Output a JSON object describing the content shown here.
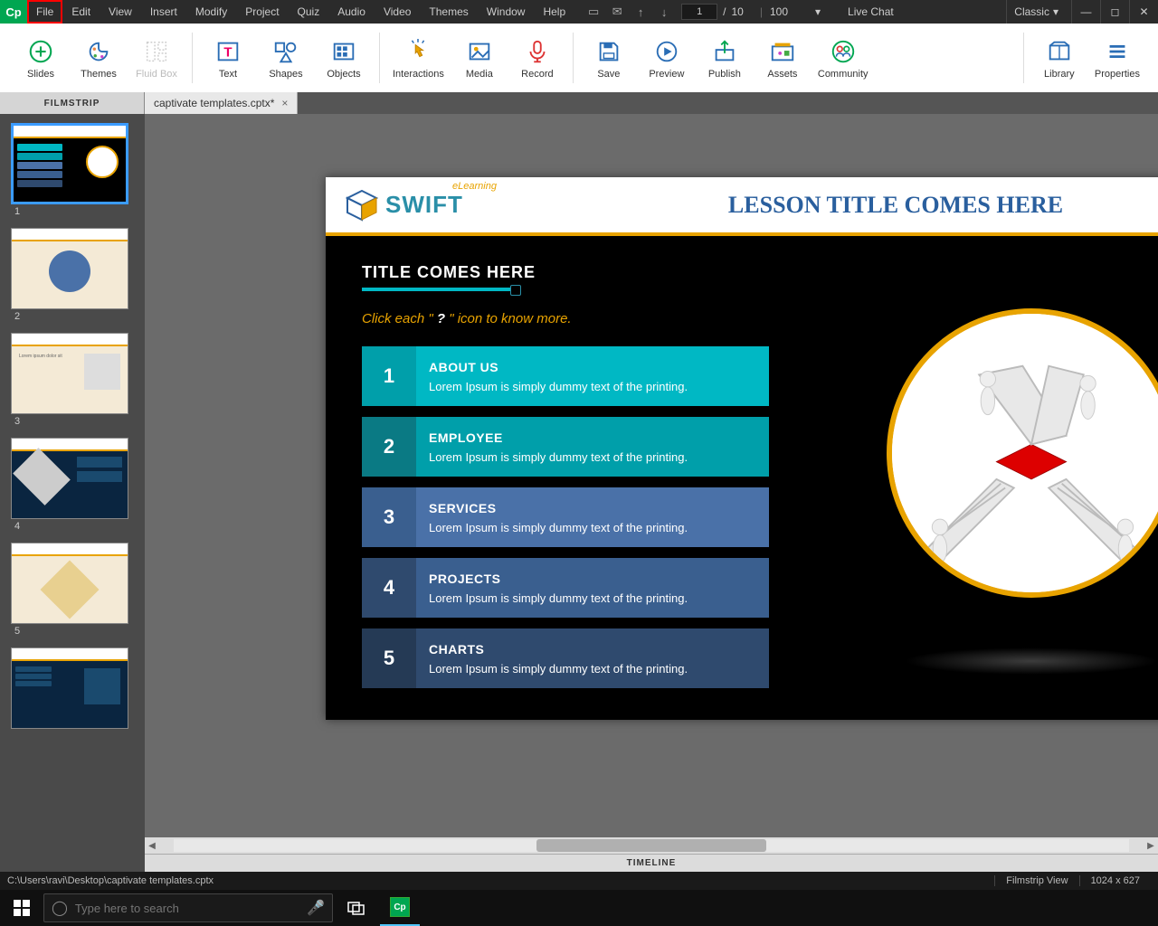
{
  "menubar": {
    "items": [
      "File",
      "Edit",
      "View",
      "Insert",
      "Modify",
      "Project",
      "Quiz",
      "Audio",
      "Video",
      "Themes",
      "Window",
      "Help"
    ],
    "slide_current": "1",
    "slide_sep": "/",
    "slide_total": "10",
    "zoom": "100",
    "live_chat": "Live Chat",
    "workspace": "Classic"
  },
  "ribbon": {
    "slides": "Slides",
    "themes": "Themes",
    "fluid": "Fluid Box",
    "text": "Text",
    "shapes": "Shapes",
    "objects": "Objects",
    "interactions": "Interactions",
    "media": "Media",
    "record": "Record",
    "save": "Save",
    "preview": "Preview",
    "publish": "Publish",
    "assets": "Assets",
    "community": "Community",
    "library": "Library",
    "properties": "Properties"
  },
  "filmstrip_label": "FILMSTRIP",
  "doc_tab": "captivate templates.cptx*",
  "thumbs": [
    "1",
    "2",
    "3",
    "4",
    "5"
  ],
  "slide": {
    "brand": "SWIFT",
    "elearn": "eLearning",
    "lesson": "LESSON TITLE COMES HERE",
    "section": "TITLE COMES HERE",
    "hint_pre": "Click each \" ",
    "hint_q": "?",
    "hint_post": " \" icon to know more.",
    "items": [
      {
        "n": "1",
        "t": "ABOUT US",
        "d": "Lorem Ipsum is simply dummy text of the printing."
      },
      {
        "n": "2",
        "t": "EMPLOYEE",
        "d": "Lorem Ipsum is simply dummy text of the printing."
      },
      {
        "n": "3",
        "t": "SERVICES",
        "d": "Lorem Ipsum is simply dummy text of the printing."
      },
      {
        "n": "4",
        "t": "PROJECTS",
        "d": "Lorem Ipsum is simply dummy text of the printing."
      },
      {
        "n": "5",
        "t": "CHARTS",
        "d": "Lorem Ipsum is simply dummy text of the printing."
      }
    ]
  },
  "timeline": "TIMELINE",
  "status": {
    "path": "C:\\Users\\ravi\\Desktop\\captivate templates.cptx",
    "view": "Filmstrip View",
    "dim": "1024 x 627"
  },
  "taskbar": {
    "search_placeholder": "Type here to search"
  }
}
